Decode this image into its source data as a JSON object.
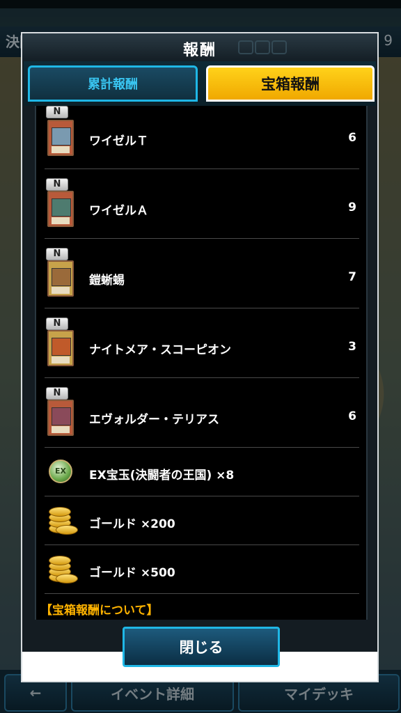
{
  "background": {
    "header_title": "決闘",
    "header_number": "9",
    "bottom_buttons": [
      {
        "label": "←"
      },
      {
        "label": "イベント詳細"
      },
      {
        "label": "マイデッキ"
      }
    ]
  },
  "dialog": {
    "title": "報酬",
    "tabs": [
      {
        "label": "累計報酬",
        "active": false
      },
      {
        "label": "宝箱報酬",
        "active": true
      }
    ],
    "rewards": [
      {
        "type": "card",
        "rarity": "N",
        "name": "ワイゼルＴ",
        "count": "6",
        "art_color": "#7a9ab0"
      },
      {
        "type": "card",
        "rarity": "N",
        "name": "ワイゼルＡ",
        "count": "9",
        "art_color": "#4e7b6f"
      },
      {
        "type": "card",
        "rarity": "N",
        "name": "鎧蜥蜴",
        "count": "7",
        "art_color": "#9a6a3a"
      },
      {
        "type": "card",
        "rarity": "N",
        "name": "ナイトメア・スコーピオン",
        "count": "3",
        "art_color": "#c05a2a"
      },
      {
        "type": "card",
        "rarity": "N",
        "name": "エヴォルダー・テリアス",
        "count": "6",
        "art_color": "#8a4a5a"
      },
      {
        "type": "gem",
        "icon_text": "EX",
        "name": "EX宝玉(決闘者の王国) ×8"
      },
      {
        "type": "gold",
        "name": "ゴールド ×200"
      },
      {
        "type": "gold",
        "name": "ゴールド ×500"
      }
    ],
    "about_section": "【宝箱報酬について】",
    "close_label": "閉じる"
  },
  "colors": {
    "accent_blue": "#1fb7e6",
    "active_tab_yellow": "#ffd21a",
    "section_orange": "#ffb300"
  }
}
